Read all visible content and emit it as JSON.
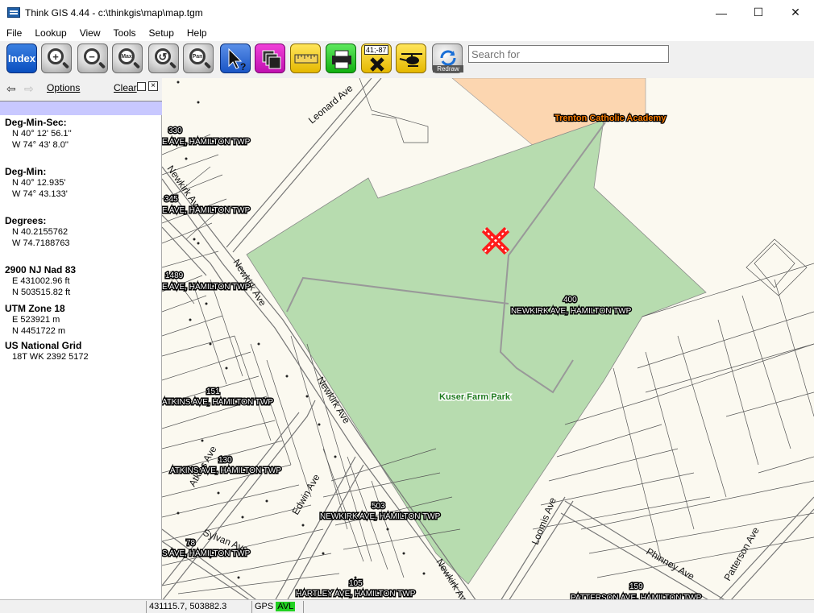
{
  "window": {
    "title": "Think GIS 4.44 - c:\\thinkgis\\map\\map.tgm",
    "minimize": "—",
    "maximize": "☐",
    "close": "✕"
  },
  "menu": [
    "File",
    "Lookup",
    "View",
    "Tools",
    "Setup",
    "Help"
  ],
  "toolbar": {
    "index_label": "Index",
    "max_label": "Max",
    "pan_label": "Pan",
    "coord_label": "41;-87",
    "redraw_label": "Redraw",
    "search_placeholder": "Search for"
  },
  "side_panel": {
    "options": "Options",
    "clear": "Clear",
    "groups": [
      {
        "title": "Deg-Min-Sec:",
        "lines": [
          "N 40° 12' 56.1''",
          "W 74° 43' 8.0''"
        ]
      },
      {
        "title": "Deg-Min:",
        "lines": [
          "N 40° 12.935'",
          "W 74° 43.133'"
        ]
      },
      {
        "title": "Degrees:",
        "lines": [
          "N 40.2155762",
          "W 74.7188763"
        ]
      },
      {
        "title": "2900 NJ Nad 83",
        "lines": [
          "E 431002.96 ft",
          "N 503515.82 ft"
        ]
      },
      {
        "title": "UTM Zone 18",
        "lines": [
          "E 523921 m",
          "N 4451722 m"
        ]
      },
      {
        "title": "US National Grid",
        "lines": [
          "18T WK 2392 5172"
        ]
      }
    ]
  },
  "map": {
    "streets": [
      "Leonard Ave",
      "Newkirk Ave",
      "Newkirk Ave",
      "Newkirk Ave",
      "Atkins Ave",
      "Edwin Ave",
      "Sylvan Ave",
      "Newkirk Ave",
      "Loomis Ave",
      "Phinney Ave",
      "Patterson Ave"
    ],
    "places": {
      "academy": "Trenton Catholic Academy",
      "park": "Kuser Farm Park"
    },
    "parcels": [
      {
        "number": "330",
        "address": "E AVE, HAMILTON TWP"
      },
      {
        "number": "345",
        "address": "E AVE, HAMILTON TWP"
      },
      {
        "number": "1489",
        "address": "E AVE, HAMILTON TWP"
      },
      {
        "number": "400",
        "address": "NEWKIRK AVE, HAMILTON TWP"
      },
      {
        "number": "151",
        "address": "ATKINS AVE, HAMILTON TWP"
      },
      {
        "number": "130",
        "address": "ATKINS AVE, HAMILTON TWP"
      },
      {
        "number": "503",
        "address": "NEWKIRK AVE, HAMILTON TWP"
      },
      {
        "number": "78",
        "address": "S AVE, HAMILTON TWP"
      },
      {
        "number": "105",
        "address": "HARTLEY AVE, HAMILTON TWP"
      },
      {
        "number": "159",
        "address": "PATTERSON AVE, HAMILTON TWP"
      }
    ],
    "colors": {
      "park": "#b7dcaf",
      "academy": "#fcd6b0",
      "marker": "#ff1a1a"
    }
  },
  "status": {
    "coords": "431115.7, 503882.3",
    "gps": "GPS",
    "avl": "AVL"
  }
}
